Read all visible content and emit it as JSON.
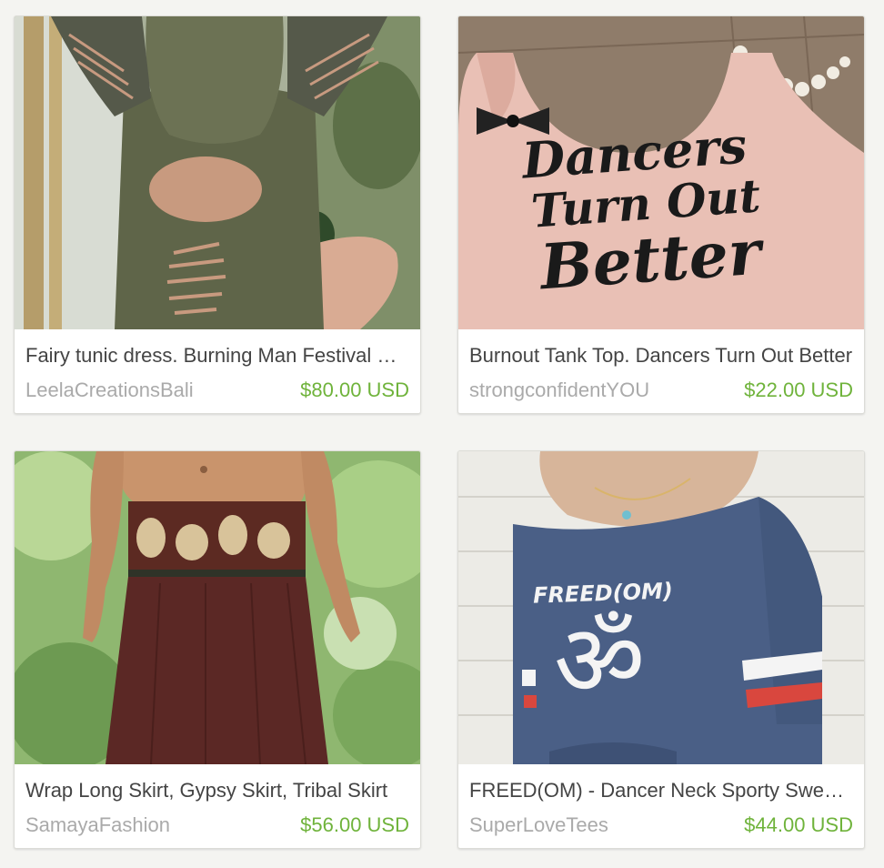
{
  "listings": [
    {
      "title": "Fairy tunic dress. Burning Man Festival Clothing",
      "shop": "LeelaCreationsBali",
      "price": "$80.00 USD"
    },
    {
      "title": "Burnout Tank Top. Dancers Turn Out Better",
      "shop": "strongconfidentYOU",
      "price": "$22.00 USD",
      "image_text": [
        "Dancers",
        "Turn Out",
        "Better"
      ]
    },
    {
      "title": "Wrap Long Skirt, Gypsy Skirt, Tribal Skirt",
      "shop": "SamayaFashion",
      "price": "$56.00 USD"
    },
    {
      "title": "FREED(OM) - Dancer Neck Sporty Sweatshirt",
      "shop": "SuperLoveTees",
      "price": "$44.00 USD",
      "image_text": [
        "FREED(OM)",
        "ॐ"
      ]
    }
  ],
  "colors": {
    "price": "#6fb33b",
    "shop": "#aaaaaa",
    "title": "#444444",
    "page_bg": "#f4f4f1"
  }
}
